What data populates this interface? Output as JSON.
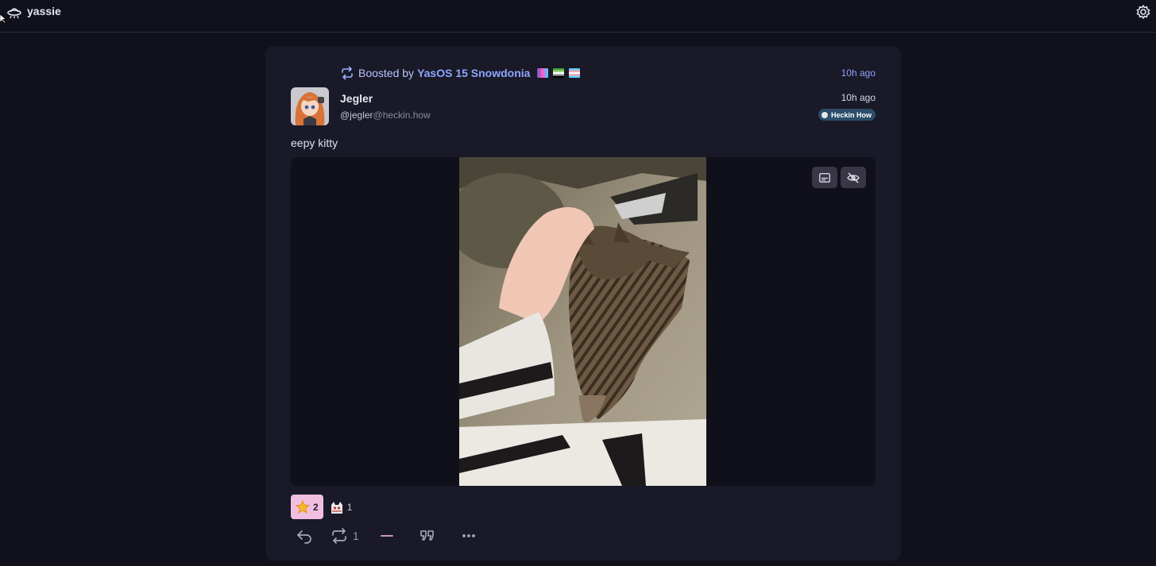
{
  "topbar": {
    "account_name": "yassie"
  },
  "post": {
    "boost_prefix": "Boosted by",
    "booster_name": "YasOS 15 Snowdonia",
    "boost_time": "10h ago",
    "author_name": "Jegler",
    "author_handle": "@jegler",
    "author_domain": "@heckin.how",
    "post_time": "10h ago",
    "instance_name": "Heckin How",
    "content": "eepy kitty",
    "reactions": [
      {
        "emoji": "star-emoji",
        "count": "2"
      },
      {
        "emoji": "neocat-emoji",
        "count": "1"
      }
    ],
    "actions": {
      "reply_icon": "reply-icon",
      "boost_icon": "boost-icon",
      "boost_count": "1",
      "like_icon": "minus-icon",
      "quote_icon": "quote-icon",
      "more_icon": "more-icon"
    }
  },
  "colors": {
    "background": "#11111c",
    "card": "#191927",
    "accent": "#8fa6ff",
    "reaction_active": "#f0bfe0"
  }
}
